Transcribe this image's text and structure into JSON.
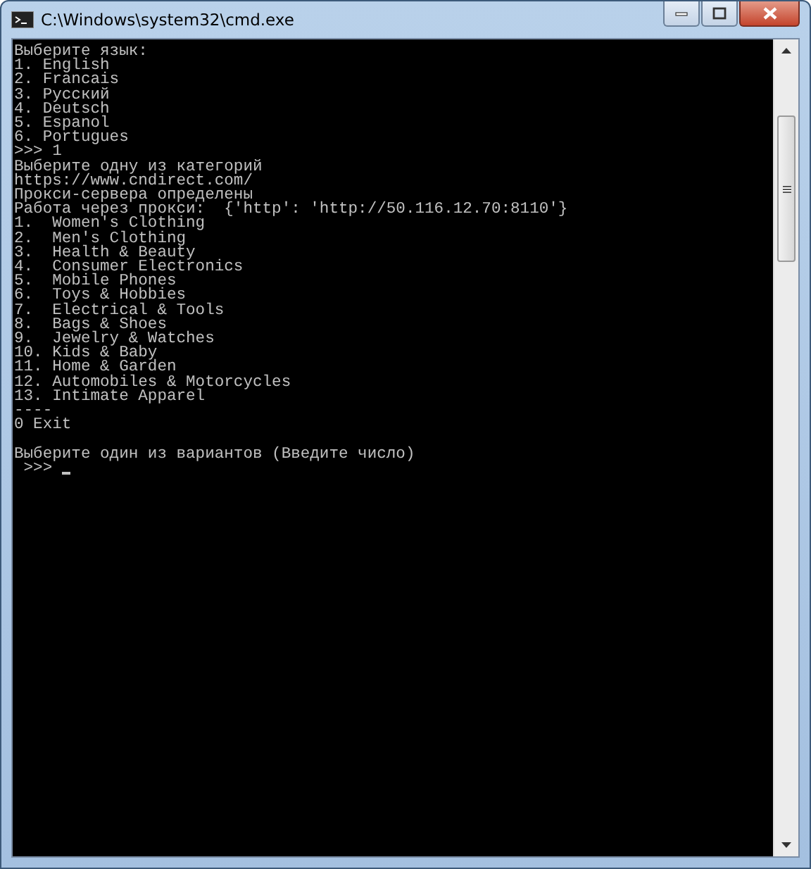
{
  "window": {
    "title": "C:\\Windows\\system32\\cmd.exe"
  },
  "console": {
    "lines": [
      {
        "kind": "text",
        "text": "Выберите язык:"
      },
      {
        "kind": "text",
        "text": "1. English"
      },
      {
        "kind": "text",
        "text": "2. Francais"
      },
      {
        "kind": "text",
        "text": "3. Русский"
      },
      {
        "kind": "text",
        "text": "4. Deutsch"
      },
      {
        "kind": "text",
        "text": "5. Espanol"
      },
      {
        "kind": "text",
        "text": "6. Portugues"
      },
      {
        "kind": "text",
        "text": ">>> 1"
      },
      {
        "kind": "text",
        "text": "Выберите одну из категорий"
      },
      {
        "kind": "text",
        "text": "https://www.cndirect.com/"
      },
      {
        "kind": "text",
        "text": "Прокси-сервера определены"
      },
      {
        "kind": "text",
        "text": "Работа через прокси:  {'http': 'http://50.116.12.70:8110'}"
      },
      {
        "kind": "text",
        "text": "1.  Women's Clothing"
      },
      {
        "kind": "text",
        "text": "2.  Men's Clothing"
      },
      {
        "kind": "text",
        "text": "3.  Health & Beauty"
      },
      {
        "kind": "text",
        "text": "4.  Consumer Electronics"
      },
      {
        "kind": "text",
        "text": "5.  Mobile Phones"
      },
      {
        "kind": "text",
        "text": "6.  Toys & Hobbies"
      },
      {
        "kind": "text",
        "text": "7.  Electrical & Tools"
      },
      {
        "kind": "text",
        "text": "8.  Bags & Shoes"
      },
      {
        "kind": "text",
        "text": "9.  Jewelry & Watches"
      },
      {
        "kind": "text",
        "text": "10. Kids & Baby"
      },
      {
        "kind": "text",
        "text": "11. Home & Garden"
      },
      {
        "kind": "text",
        "text": "12. Automobiles & Motorcycles"
      },
      {
        "kind": "text",
        "text": "13. Intimate Apparel"
      },
      {
        "kind": "text",
        "text": "----"
      },
      {
        "kind": "text",
        "text": "0 Exit"
      },
      {
        "kind": "blank"
      },
      {
        "kind": "text",
        "text": "Выберите один из вариантов (Введите число)"
      },
      {
        "kind": "prompt",
        "text": " >>>"
      }
    ]
  }
}
